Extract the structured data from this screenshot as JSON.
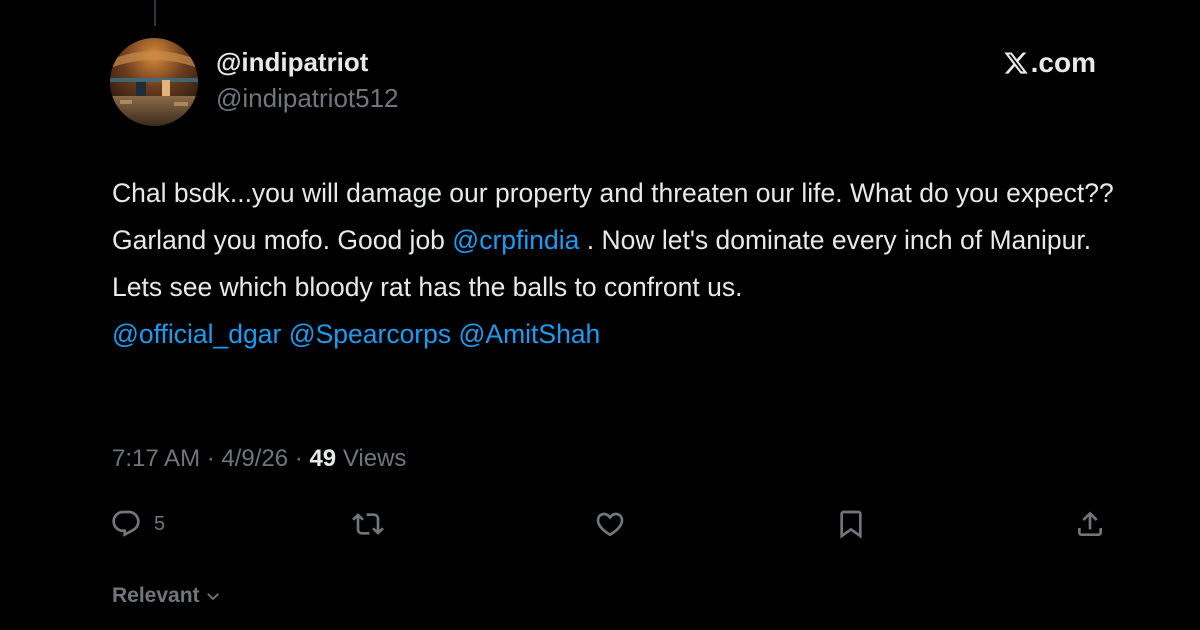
{
  "author": {
    "display_name": "@indipatriot",
    "handle": "@indipatriot512"
  },
  "site": {
    "label": ".com"
  },
  "tweet": {
    "parts": [
      "Chal bsdk...you will damage our property and threaten our life. What do you expect?? Garland you mofo. Good job ",
      "@crpfindia",
      " . Now let's dominate every inch of Manipur. Lets see which bloody rat has the balls to confront us.",
      "@official_dgar",
      " ",
      "@Spearcorps",
      " ",
      "@AmitShah"
    ]
  },
  "meta": {
    "time": "7:17 AM",
    "sep1": " · ",
    "date": "4/9/26",
    "sep2": " · ",
    "views_count": "49",
    "views_label": " Views"
  },
  "actions": {
    "reply_count": "5",
    "icons": [
      "reply-icon",
      "retweet-icon",
      "like-icon",
      "bookmark-icon",
      "share-icon"
    ]
  },
  "sort": {
    "label": "Relevant"
  },
  "colors": {
    "accent": "#1d9bf0",
    "muted": "#71767b",
    "text": "#e7e9ea",
    "background": "#000000"
  }
}
